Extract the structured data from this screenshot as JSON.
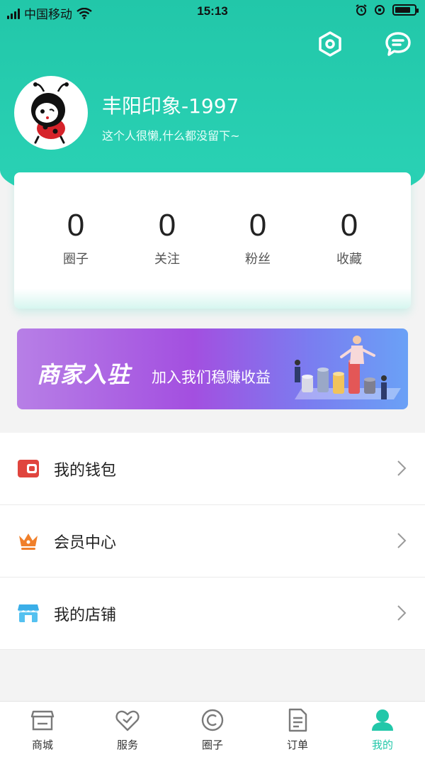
{
  "status_bar": {
    "carrier": "中国移动",
    "time": "15:13"
  },
  "header": {
    "settings_icon": "hexagon-settings-icon",
    "message_icon": "chat-bubble-icon",
    "username": "丰阳印象-1997",
    "bio": "这个人很懒,什么都没留下~"
  },
  "stats": [
    {
      "value": "0",
      "label": "圈子"
    },
    {
      "value": "0",
      "label": "关注"
    },
    {
      "value": "0",
      "label": "粉丝"
    },
    {
      "value": "0",
      "label": "收藏"
    }
  ],
  "banner": {
    "title": "商家入驻",
    "subtitle": "加入我们稳赚收益"
  },
  "menu": [
    {
      "label": "我的钱包",
      "icon": "wallet-icon"
    },
    {
      "label": "会员中心",
      "icon": "crown-icon"
    },
    {
      "label": "我的店铺",
      "icon": "store-icon"
    }
  ],
  "tabbar": [
    {
      "label": "商城",
      "icon": "shop-icon"
    },
    {
      "label": "服务",
      "icon": "heart-service-icon"
    },
    {
      "label": "圈子",
      "icon": "circle-icon"
    },
    {
      "label": "订单",
      "icon": "order-icon"
    },
    {
      "label": "我的",
      "icon": "user-icon",
      "active": true
    }
  ],
  "colors": {
    "accent": "#22c7a9",
    "banner_start": "#b77fe6",
    "banner_end": "#6aa1f6"
  }
}
